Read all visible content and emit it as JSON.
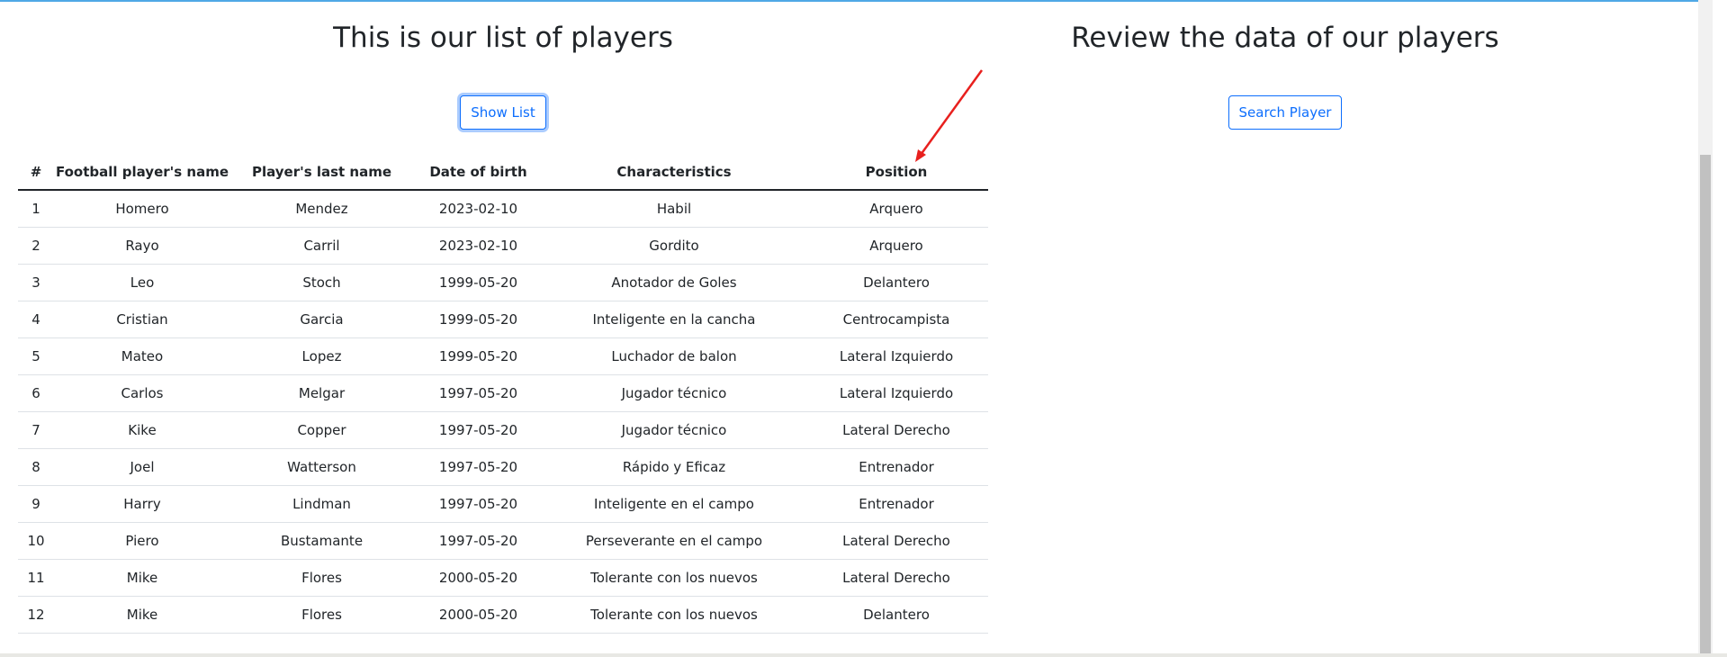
{
  "left": {
    "title": "This is our list of players",
    "show_list_label": "Show List",
    "table": {
      "headers": [
        "#",
        "Football player's name",
        "Player's last name",
        "Date of birth",
        "Characteristics",
        "Position"
      ],
      "rows": [
        [
          "1",
          "Homero",
          "Mendez",
          "2023-02-10",
          "Habil",
          "Arquero"
        ],
        [
          "2",
          "Rayo",
          "Carril",
          "2023-02-10",
          "Gordito",
          "Arquero"
        ],
        [
          "3",
          "Leo",
          "Stoch",
          "1999-05-20",
          "Anotador de Goles",
          "Delantero"
        ],
        [
          "4",
          "Cristian",
          "Garcia",
          "1999-05-20",
          "Inteligente en la cancha",
          "Centrocampista"
        ],
        [
          "5",
          "Mateo",
          "Lopez",
          "1999-05-20",
          "Luchador de balon",
          "Lateral Izquierdo"
        ],
        [
          "6",
          "Carlos",
          "Melgar",
          "1997-05-20",
          "Jugador técnico",
          "Lateral Izquierdo"
        ],
        [
          "7",
          "Kike",
          "Copper",
          "1997-05-20",
          "Jugador técnico",
          "Lateral Derecho"
        ],
        [
          "8",
          "Joel",
          "Watterson",
          "1997-05-20",
          "Rápido y Eficaz",
          "Entrenador"
        ],
        [
          "9",
          "Harry",
          "Lindman",
          "1997-05-20",
          "Inteligente en el campo",
          "Entrenador"
        ],
        [
          "10",
          "Piero",
          "Bustamante",
          "1997-05-20",
          "Perseverante en el campo",
          "Lateral Derecho"
        ],
        [
          "11",
          "Mike",
          "Flores",
          "2000-05-20",
          "Tolerante con los nuevos",
          "Lateral Derecho"
        ],
        [
          "12",
          "Mike",
          "Flores",
          "2000-05-20",
          "Tolerante con los nuevos",
          "Delantero"
        ]
      ]
    }
  },
  "right": {
    "title": "Review the data of our players",
    "search_player_label": "Search Player"
  },
  "colors": {
    "accent": "#0d6efd",
    "annotation_arrow": "#e8201e",
    "top_line": "#4fa8e6"
  }
}
